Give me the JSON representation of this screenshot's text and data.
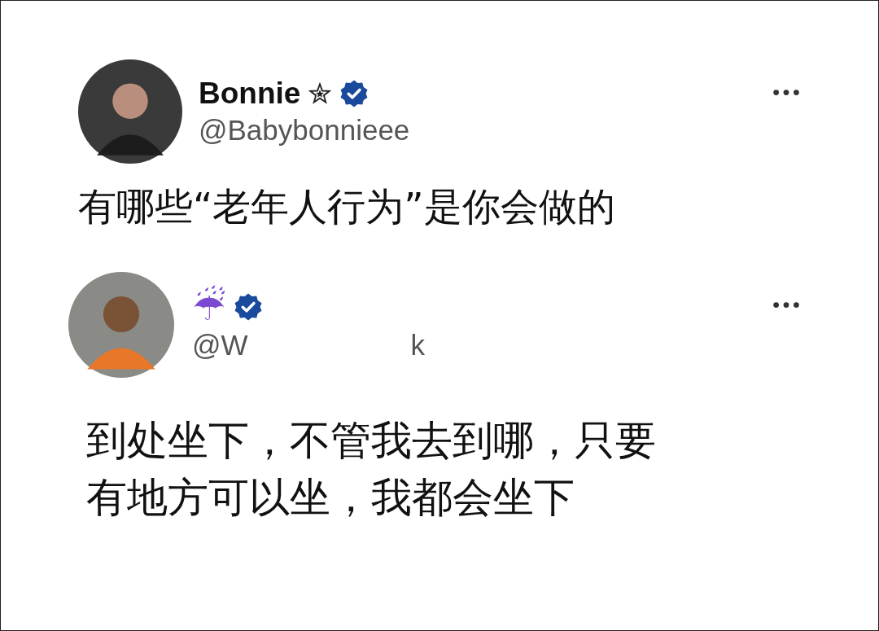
{
  "posts": [
    {
      "name": "Bonnie",
      "star_badge": true,
      "verified": true,
      "handle_parts": [
        "@Babybonnieee"
      ],
      "text_lines": [
        "有哪些“老年人行为”是你会做的"
      ]
    },
    {
      "name": "☔",
      "star_badge": false,
      "verified": true,
      "handle_parts": [
        "@W",
        "k"
      ],
      "text_lines": [
        "到处坐下，不管我去到哪，只要",
        "有地方可以坐，我都会坐下"
      ]
    }
  ]
}
